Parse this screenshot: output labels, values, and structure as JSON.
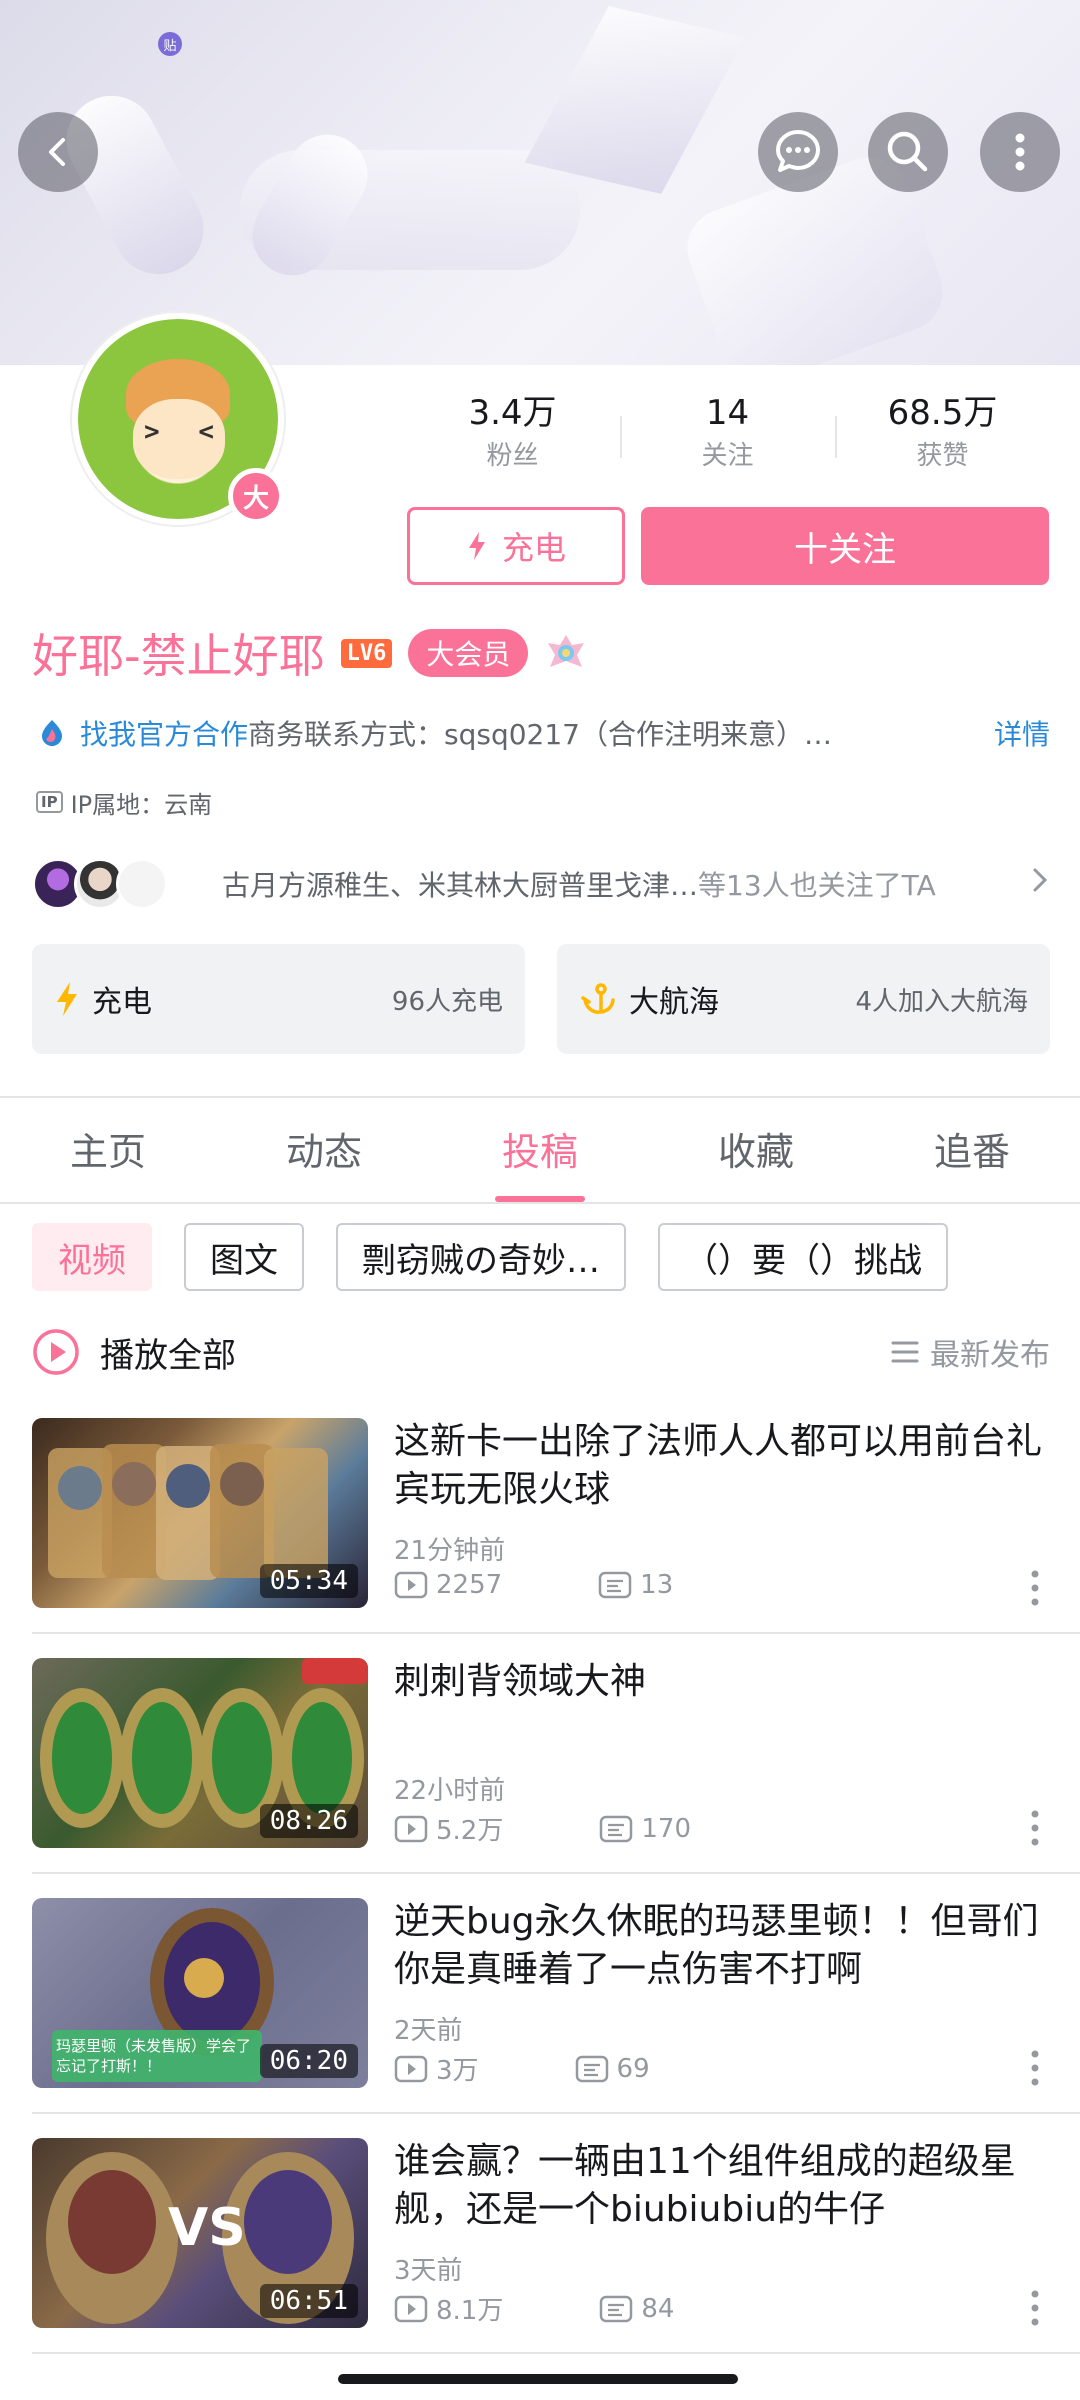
{
  "status_badge": "贴",
  "profile": {
    "username": "好耶-禁止好耶",
    "level_badge": "LV6",
    "vip_badge": "大会员",
    "vip_dot": "大",
    "stats": [
      {
        "value": "3.4万",
        "label": "粉丝"
      },
      {
        "value": "14",
        "label": "关注"
      },
      {
        "value": "68.5万",
        "label": "获赞"
      }
    ],
    "charge_label": "充电",
    "follow_label": "十关注",
    "bio_link": "找我官方合作",
    "bio_text": "商务联系方式：sqsq0217（合作注明来意）…",
    "bio_detail": "详情",
    "ip_tag": "IP",
    "ip_text": "IP属地：云南",
    "mutual_names": "古月方源稚生、米其林大厨普里戈津…",
    "mutual_suffix": "等13人也关注了TA"
  },
  "cards": [
    {
      "title": "充电",
      "sub": "96人充电"
    },
    {
      "title": "大航海",
      "sub": "4人加入大航海"
    }
  ],
  "tabs": [
    "主页",
    "动态",
    "投稿",
    "收藏",
    "追番"
  ],
  "active_tab": "投稿",
  "filters": [
    "视频",
    "图文",
    "剽窃贼の奇妙…",
    "（）要（）挑战"
  ],
  "play_all": "播放全部",
  "sort_label": "最新发布",
  "videos": [
    {
      "title": "这新卡一出除了法师人人都可以用前台礼宾玩无限火球",
      "time": "21分钟前",
      "plays": "2257",
      "comments": "13",
      "duration": "05:34"
    },
    {
      "title": "刺刺背领域大神",
      "time": "22小时前",
      "plays": "5.2万",
      "comments": "170",
      "duration": "08:26"
    },
    {
      "title": "逆天bug永久休眠的玛瑟里顿！！但哥们你是真睡着了一点伤害不打啊",
      "time": "2天前",
      "plays": "3万",
      "comments": "69",
      "duration": "06:20",
      "thumb_caption": "玛瑟里顿（未发售版）学会了忘记了打斯！！"
    },
    {
      "title": "谁会赢？一辆由11个组件组成的超级星舰，还是一个biubiubiu的牛仔",
      "time": "3天前",
      "plays": "8.1万",
      "comments": "84",
      "duration": "06:51",
      "thumb_caption": "VS"
    }
  ],
  "colors": {
    "accent": "#fb7299",
    "link": "#2b8ad8",
    "text_secondary": "#9499a0"
  }
}
